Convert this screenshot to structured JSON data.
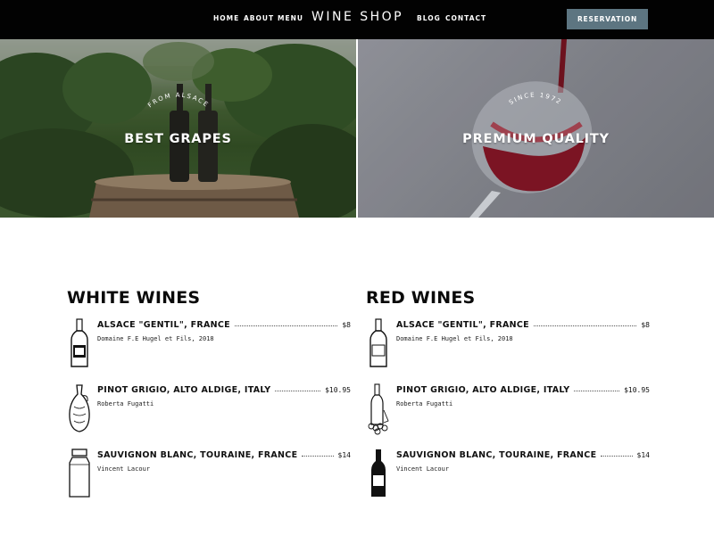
{
  "header": {
    "nav_left": [
      "HOME",
      "ABOUT",
      "MENU"
    ],
    "brand": "WINE SHOP",
    "nav_right": [
      "BLOG",
      "CONTACT"
    ],
    "cta_label": "RESERVATION",
    "cta_color": "#5d7581"
  },
  "hero": {
    "left": {
      "arc_text": "FROM ALSACE",
      "title": "BEST GRAPES"
    },
    "right": {
      "arc_text": "SINCE 1972",
      "title": "PREMIUM QUALITY"
    }
  },
  "menu": {
    "white": {
      "title": "WHITE WINES",
      "items": [
        {
          "name": "ALSACE \"GENTIL\", FRANCE",
          "price": "$8",
          "sub": "Domaine F.E Hugel et Fils, 2018",
          "icon": "wine-bottle-icon"
        },
        {
          "name": "PINOT GRIGIO, ALTO ALDIGE, ITALY",
          "price": "$10.95",
          "sub": "Roberta Fugatti",
          "icon": "decanter-icon"
        },
        {
          "name": "SAUVIGNON BLANC, TOURAINE, FRANCE",
          "price": "$14",
          "sub": "Vincent Lacour",
          "icon": "jar-icon"
        }
      ]
    },
    "red": {
      "title": "RED WINES",
      "items": [
        {
          "name": "ALSACE \"GENTIL\", FRANCE",
          "price": "$8",
          "sub": "Domaine F.E Hugel et Fils, 2018",
          "icon": "wine-bottle-icon"
        },
        {
          "name": "PINOT GRIGIO, ALTO ALDIGE, ITALY",
          "price": "$10.95",
          "sub": "Roberta Fugatti",
          "icon": "bottle-with-grapes-icon"
        },
        {
          "name": "SAUVIGNON BLANC, TOURAINE, FRANCE",
          "price": "$14",
          "sub": "Vincent Lacour",
          "icon": "wine-bottle-icon"
        }
      ]
    }
  }
}
